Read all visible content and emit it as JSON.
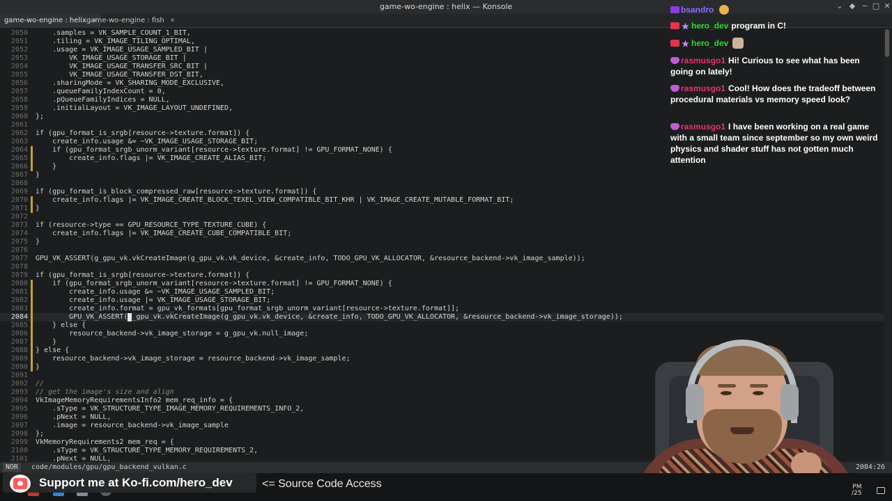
{
  "window": {
    "title": "game-wo-engine : helix — Konsole",
    "buttons": [
      "⌄",
      "◆",
      "−",
      "□",
      "✕"
    ]
  },
  "tabs": [
    {
      "label": "game-wo-engine : helix",
      "active": true
    },
    {
      "label": "game-wo-engine : fish",
      "active": false
    }
  ],
  "editor": {
    "cursor_line": "2084",
    "lines": [
      {
        "n": "2050",
        "text": "    .samples = VK_SAMPLE_COUNT_1_BIT,"
      },
      {
        "n": "2051",
        "text": "    .tiling = VK_IMAGE_TILING_OPTIMAL,"
      },
      {
        "n": "2052",
        "text": "    .usage = VK_IMAGE_USAGE_SAMPLED_BIT |"
      },
      {
        "n": "2053",
        "text": "        VK_IMAGE_USAGE_STORAGE_BIT |"
      },
      {
        "n": "2054",
        "text": "        VK_IMAGE_USAGE_TRANSFER_SRC_BIT |"
      },
      {
        "n": "2055",
        "text": "        VK_IMAGE_USAGE_TRANSFER_DST_BIT,"
      },
      {
        "n": "2056",
        "text": "    .sharingMode = VK_SHARING_MODE_EXCLUSIVE,"
      },
      {
        "n": "2057",
        "text": "    .queueFamilyIndexCount = 0,"
      },
      {
        "n": "2058",
        "text": "    .pQueueFamilyIndices = NULL,"
      },
      {
        "n": "2059",
        "text": "    .initialLayout = VK_IMAGE_LAYOUT_UNDEFINED,"
      },
      {
        "n": "2060",
        "text": "};"
      },
      {
        "n": "2061",
        "text": ""
      },
      {
        "n": "2062",
        "text": "if (gpu_format_is_srgb[resource->texture.format]) {"
      },
      {
        "n": "2063",
        "text": "    create_info.usage &= ~VK_IMAGE_USAGE_STORAGE_BIT;"
      },
      {
        "n": "2064",
        "text": "    if (gpu_format_srgb_unorm_variant[resource->texture.format] != GPU_FORMAT_NONE) {"
      },
      {
        "n": "2065",
        "text": "        create_info.flags |= VK_IMAGE_CREATE_ALIAS_BIT;"
      },
      {
        "n": "2066",
        "text": "    }"
      },
      {
        "n": "2067",
        "text": "}"
      },
      {
        "n": "2068",
        "text": ""
      },
      {
        "n": "2069",
        "text": "if (gpu_format_is_block_compressed_raw[resource->texture.format]) {"
      },
      {
        "n": "2070",
        "text": "    create_info.flags |= VK_IMAGE_CREATE_BLOCK_TEXEL_VIEW_COMPATIBLE_BIT_KHR | VK_IMAGE_CREATE_MUTABLE_FORMAT_BIT;"
      },
      {
        "n": "2071",
        "text": "}"
      },
      {
        "n": "2072",
        "text": ""
      },
      {
        "n": "2073",
        "text": "if (resource->type == GPU_RESOURCE_TYPE_TEXTURE_CUBE) {"
      },
      {
        "n": "2074",
        "text": "    create_info.flags |= VK_IMAGE_CREATE_CUBE_COMPATIBLE_BIT;"
      },
      {
        "n": "2075",
        "text": "}"
      },
      {
        "n": "2076",
        "text": ""
      },
      {
        "n": "2077",
        "text": "GPU_VK_ASSERT(g_gpu_vk.vkCreateImage(g_gpu_vk.vk_device, &create_info, TODO_GPU_VK_ALLOCATOR, &resource_backend->vk_image_sample));"
      },
      {
        "n": "2078",
        "text": ""
      },
      {
        "n": "2079",
        "text": "if (gpu_format_is_srgb[resource->texture.format]) {"
      },
      {
        "n": "2080",
        "text": "    if (gpu_format_srgb_unorm_variant[resource->texture.format] != GPU_FORMAT_NONE) {"
      },
      {
        "n": "2081",
        "text": "        create_info.usage &= ~VK_IMAGE_USAGE_SAMPLED_BIT;"
      },
      {
        "n": "2082",
        "text": "        create_info.usage |= VK_IMAGE_USAGE_STORAGE_BIT;"
      },
      {
        "n": "2083",
        "text": "        create_info.format = gpu_vk_formats[gpu_format_srgb_unorm_variant[resource->texture.format]];"
      },
      {
        "n": "2084",
        "text": "        GPU_VK_ASSERT(g_gpu_vk.vkCreateImage(g_gpu_vk.vk_device, &create_info, TODO_GPU_VK_ALLOCATOR, &resource_backend->vk_image_storage));"
      },
      {
        "n": "2085",
        "text": "    } else {"
      },
      {
        "n": "2086",
        "text": "        resource_backend->vk_image_storage = g_gpu_vk.null_image;"
      },
      {
        "n": "2087",
        "text": "    }"
      },
      {
        "n": "2088",
        "text": "} else {"
      },
      {
        "n": "2089",
        "text": "    resource_backend->vk_image_storage = resource_backend->vk_image_sample;"
      },
      {
        "n": "2090",
        "text": "}"
      },
      {
        "n": "2091",
        "text": ""
      },
      {
        "n": "2092",
        "text": "//"
      },
      {
        "n": "2093",
        "text": "// get the image's size and align"
      },
      {
        "n": "2094",
        "text": "VkImageMemoryRequirementsInfo2 mem_req_info = {"
      },
      {
        "n": "2095",
        "text": "    .sType = VK_STRUCTURE_TYPE_IMAGE_MEMORY_REQUIREMENTS_INFO_2,"
      },
      {
        "n": "2096",
        "text": "    .pNext = NULL,"
      },
      {
        "n": "2097",
        "text": "    .image = resource_backend->vk_image_sample"
      },
      {
        "n": "2098",
        "text": "};"
      },
      {
        "n": "2099",
        "text": "VkMemoryRequirements2 mem_req = {"
      },
      {
        "n": "2100",
        "text": "    .sType = VK_STRUCTURE_TYPE_MEMORY_REQUIREMENTS_2,"
      },
      {
        "n": "2101",
        "text": "    .pNext = NULL,"
      }
    ],
    "modified_lines": [
      "2064",
      "2065",
      "2066",
      "2070",
      "2071",
      "2080",
      "2081",
      "2082",
      "2083",
      "2084",
      "2085",
      "2086",
      "2087",
      "2088",
      "2089",
      "2090"
    ],
    "modified_color": "#c9a227"
  },
  "status": {
    "mode": "NOR",
    "file": "code/modules/gpu/gpu_backend_vulkan.c",
    "position": "2084:26"
  },
  "overlay": {
    "kofi_text": "Support me at Ko-fi.com/hero_dev",
    "source_text": "<= Source Code Access",
    "clock_top": "PM",
    "clock_bottom": "/25"
  },
  "chat": [
    {
      "user": "bsandro",
      "user_color": "#8f6bff",
      "badges": [
        "mod"
      ],
      "text": "",
      "emote": true
    },
    {
      "user": "hero_dev",
      "user_color": "#2bd930",
      "badges": [
        "vid",
        "star"
      ],
      "text": "program in C!"
    },
    {
      "user": "hero_dev",
      "user_color": "#2bd930",
      "badges": [
        "vid",
        "star"
      ],
      "text": "",
      "emote2": true
    },
    {
      "user": "rasmusgo1",
      "user_color": "#e8336f",
      "badges": [
        "heart"
      ],
      "text": "Hi! Curious to see what has been going on lately!"
    },
    {
      "user": "rasmusgo1",
      "user_color": "#e8336f",
      "badges": [
        "heart"
      ],
      "text": "Cool! How does the tradeoff between procedural materials vs memory speed look?"
    },
    {
      "user": "rasmusgo1",
      "user_color": "#e8336f",
      "badges": [
        "heart"
      ],
      "text": "I have been working on a real game with a small team since september so my own weird physics and shader stuff has not gotten much attention"
    }
  ]
}
